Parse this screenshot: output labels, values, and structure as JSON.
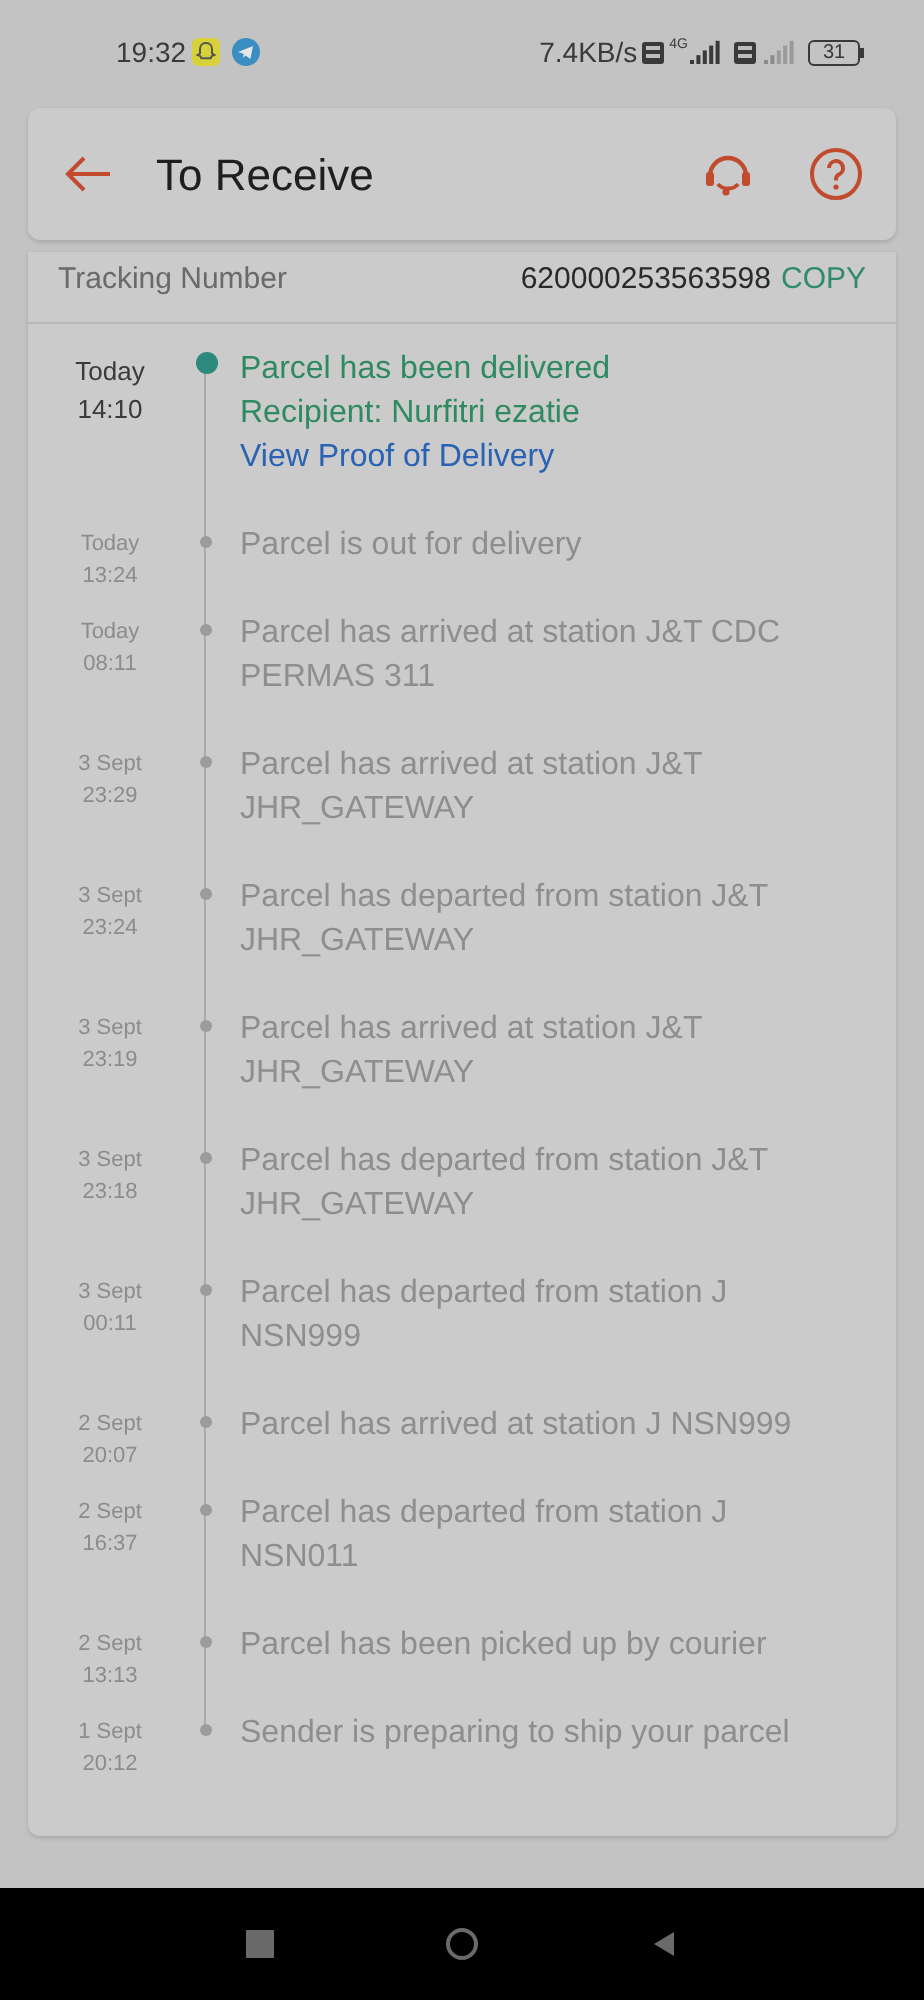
{
  "status_bar": {
    "time": "19:32",
    "speed": "7.4KB/s",
    "network": "4G",
    "battery": "31"
  },
  "header": {
    "title": "To Receive"
  },
  "tracking": {
    "label": "Tracking Number",
    "number": "620000253563598",
    "action": "COPY"
  },
  "events": [
    {
      "date": "Today",
      "time": "14:10",
      "current": true,
      "lines": [
        "Parcel has been delivered",
        "Recipient: Nurfitri ezatie"
      ],
      "link": "View Proof of Delivery"
    },
    {
      "date": "Today",
      "time": "13:24",
      "current": false,
      "lines": [
        "Parcel is out for delivery"
      ]
    },
    {
      "date": "Today",
      "time": "08:11",
      "current": false,
      "lines": [
        "Parcel has arrived at station J&T CDC PERMAS 311"
      ]
    },
    {
      "date": "3 Sept",
      "time": "23:29",
      "current": false,
      "lines": [
        "Parcel has arrived at station J&T JHR_GATEWAY"
      ]
    },
    {
      "date": "3 Sept",
      "time": "23:24",
      "current": false,
      "lines": [
        "Parcel has departed from station J&T JHR_GATEWAY"
      ]
    },
    {
      "date": "3 Sept",
      "time": "23:19",
      "current": false,
      "lines": [
        "Parcel has arrived at station J&T JHR_GATEWAY"
      ]
    },
    {
      "date": "3 Sept",
      "time": "23:18",
      "current": false,
      "lines": [
        "Parcel has departed from station J&T JHR_GATEWAY"
      ]
    },
    {
      "date": "3 Sept",
      "time": "00:11",
      "current": false,
      "lines": [
        "Parcel has departed from station J NSN999"
      ]
    },
    {
      "date": "2 Sept",
      "time": "20:07",
      "current": false,
      "lines": [
        "Parcel has arrived at station J NSN999"
      ]
    },
    {
      "date": "2 Sept",
      "time": "16:37",
      "current": false,
      "lines": [
        "Parcel has departed from station J NSN011"
      ]
    },
    {
      "date": "2 Sept",
      "time": "13:13",
      "current": false,
      "lines": [
        "Parcel has been picked up by courier"
      ]
    },
    {
      "date": "1 Sept",
      "time": "20:12",
      "current": false,
      "lines": [
        "Sender is preparing to ship your parcel"
      ]
    }
  ]
}
